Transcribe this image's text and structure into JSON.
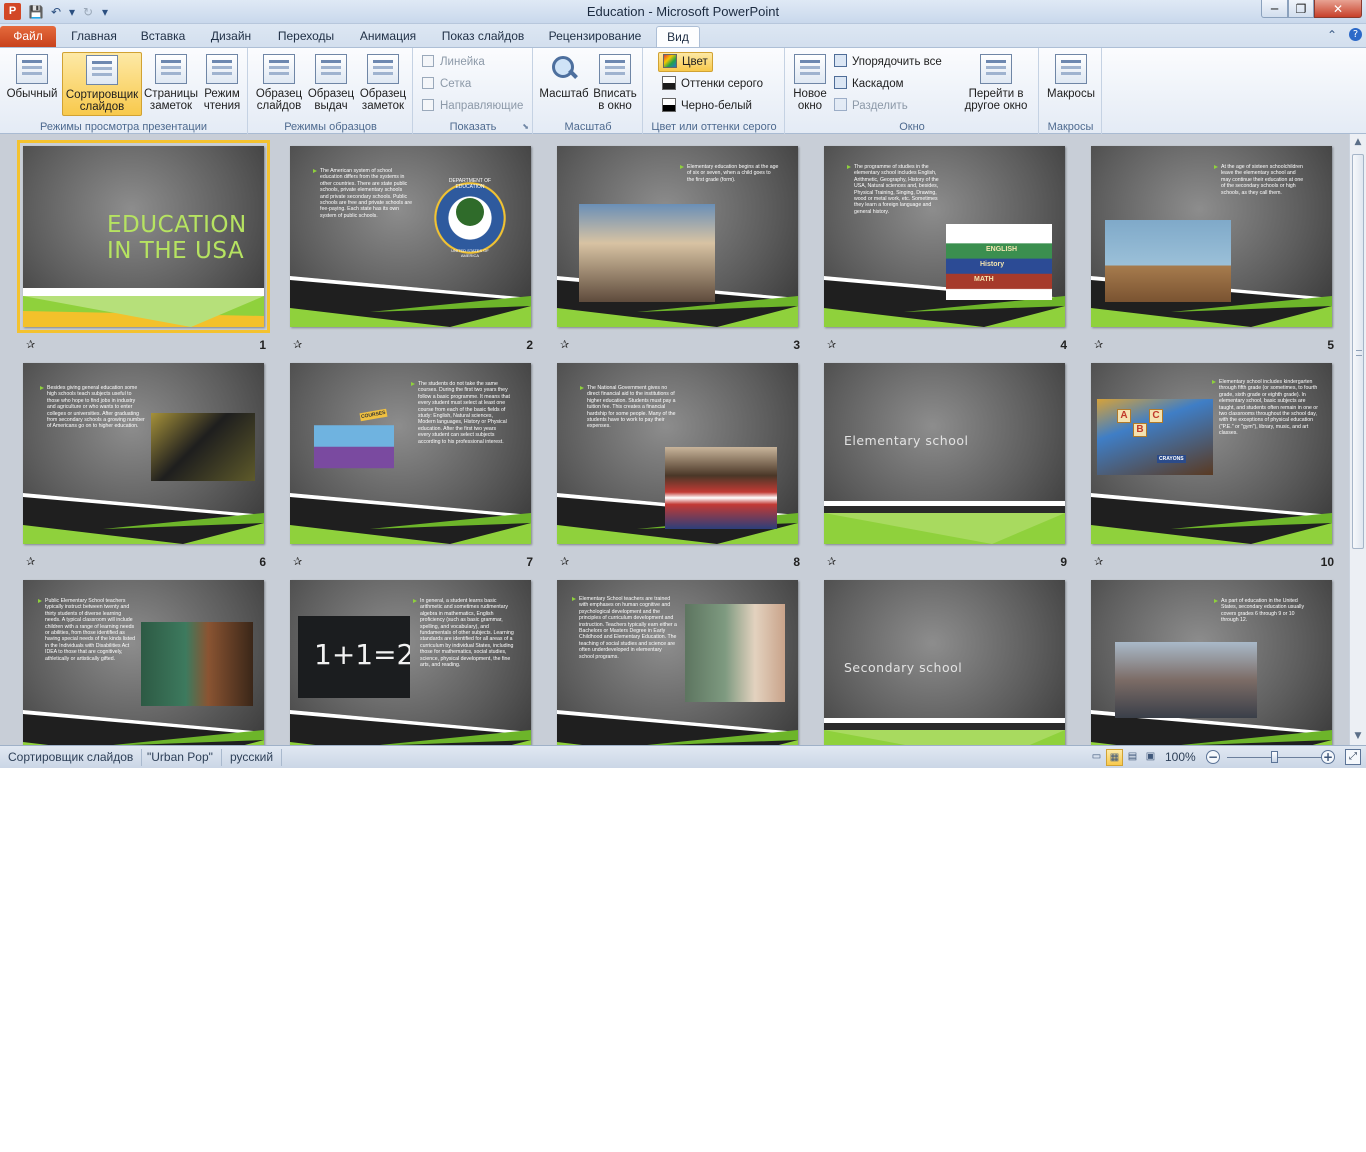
{
  "window": {
    "title": "Education  -  Microsoft PowerPoint",
    "app_logo": "P"
  },
  "qat": {
    "save": "💾",
    "undo": "↶",
    "undo_dd": "▾",
    "redo": "↻",
    "customize": "▾"
  },
  "window_controls": {
    "minimize": "─",
    "maximize": "❐",
    "close": "✕",
    "help": "?",
    "ribbon_min": "⌃"
  },
  "tabs": [
    "Файл",
    "Главная",
    "Вставка",
    "Дизайн",
    "Переходы",
    "Анимация",
    "Показ слайдов",
    "Рецензирование",
    "Вид"
  ],
  "active_tab": "Вид",
  "ribbon": {
    "presentation_views": {
      "label": "Режимы просмотра презентации",
      "buttons": [
        "Обычный",
        "Сортировщик слайдов",
        "Страницы заметок",
        "Режим чтения"
      ]
    },
    "master_views": {
      "label": "Режимы образцов",
      "buttons": [
        "Образец слайдов",
        "Образец выдач",
        "Образец заметок"
      ]
    },
    "show": {
      "label": "Показать",
      "items": [
        "Линейка",
        "Сетка",
        "Направляющие"
      ]
    },
    "zoom": {
      "label": "Масштаб",
      "buttons": [
        "Масштаб",
        "Вписать в окно"
      ]
    },
    "color": {
      "label": "Цвет или оттенки серого",
      "items": [
        "Цвет",
        "Оттенки серого",
        "Черно-белый"
      ]
    },
    "window": {
      "label": "Окно",
      "new_window": "Новое окно",
      "items": [
        "Упорядочить все",
        "Каскадом",
        "Разделить"
      ],
      "switch": "Перейти в другое окно"
    },
    "macros": {
      "label": "Макросы",
      "button": "Макросы"
    }
  },
  "slides": [
    {
      "n": "1",
      "kind": "title",
      "title": "EDUCATION IN THE USA"
    },
    {
      "n": "2",
      "kind": "text",
      "text": "The American system of school education differs from the systems in other countries. There are state public schools, private elementary schools and private secondary schools. Public schools are free and private schools are fee-paying. Each state has its own system of public schools."
    },
    {
      "n": "3",
      "kind": "text",
      "text": "Elementary education begins at the age of six or seven, when a child goes to the first grade (form)."
    },
    {
      "n": "4",
      "kind": "text",
      "text": "The programme of studies in the elementary school includes English, Arithmetic, Geography, History of the USA, Natural sciences and, besides, Physical Training, Singing, Drawing, wood or metal work, etc. Sometimes they learn a foreign language and general history."
    },
    {
      "n": "5",
      "kind": "text",
      "text": "At the age of sixteen schoolchildren leave the elementary school and may continue their education at one of the secondary schools or high schools, as they call them."
    },
    {
      "n": "6",
      "kind": "text",
      "text": "Besides giving general education some high schools teach subjects useful to those who hope to find jobs in industry and agriculture or who wants to enter colleges or universities. After graduating from secondary schools a growing number of Americans go on to higher education."
    },
    {
      "n": "7",
      "kind": "text",
      "text": "The students do not take the same courses. During the first two years they follow a basic programme. It means that every student must select at least one course from each of the basic fields of study: English, Natural sciences, Modern languages, History or Physical education. After the first two years every student can select subjects according to his professional interest."
    },
    {
      "n": "8",
      "kind": "text",
      "text": "The National Government gives no direct financial aid to the institutions of higher education. Students must pay a tuition fee. This creates a financial hardship for some people. Many of the students have to work to pay their expenses."
    },
    {
      "n": "9",
      "kind": "heading",
      "text": "Elementary school"
    },
    {
      "n": "10",
      "kind": "text",
      "text": "Elementary school includes kindergarten through fifth grade (or sometimes, to fourth grade, sixth grade or eighth grade). In elementary school, basic subjects are taught, and students often remain in one or two classrooms throughout the school day, with the exceptions of physical education (\"P.E.\" or \"gym\"), library, music, and art classes."
    },
    {
      "n": "",
      "kind": "text",
      "text": "Public Elementary School teachers typically instruct between twenty and thirty students of diverse learning needs. A typical classroom will include children with a range of learning needs or abilities, from those identified as having special needs of the kinds listed in the Individuals with Disabilities Act IDEA to those that are cognitively, athletically or artistically gifted."
    },
    {
      "n": "",
      "kind": "text",
      "text": "In general, a student learns basic arithmetic and sometimes rudimentary algebra in mathematics, English proficiency (such as basic grammar, spelling, and vocabulary), and fundamentals of other subjects. Learning standards are identified for all areas of a curriculum by individual States, including those for mathematics, social studies, science, physical development, the fine arts, and reading."
    },
    {
      "n": "",
      "kind": "text",
      "text": "Elementary School teachers are trained with emphases on human cognitive and psychological development and the principles of curriculum development and instruction. Teachers typically earn either a Bachelors or Masters Degree in Early Childhood and Elementary Education. The teaching of social studies and science are often underdeveloped in elementary school programs."
    },
    {
      "n": "",
      "kind": "heading",
      "text": "Secondary school"
    },
    {
      "n": "",
      "kind": "text",
      "text": "As part of education in the United States, secondary education usually covers grades 6 through 9 or 10 through 12."
    }
  ],
  "slide_art": {
    "seal_text": "DEPARTMENT OF EDUCATION",
    "seal_bottom": "UNITED STATES OF AMERICA",
    "books": [
      "ENGLISH",
      "History",
      "MATH"
    ],
    "board": "1+1=2",
    "crayons": "CRAYONS",
    "blocks": [
      "A",
      "B",
      "C"
    ],
    "courses": "COURSES"
  },
  "statusbar": {
    "view": "Сортировщик слайдов",
    "theme": "\"Urban Pop\"",
    "language": "русский",
    "zoom": "100%",
    "zoom_minus": "−",
    "zoom_plus": "+",
    "zoom_level": 0.5
  },
  "icons": {
    "star": "✰",
    "scroll_up": "▲",
    "scroll_down": "▼"
  }
}
